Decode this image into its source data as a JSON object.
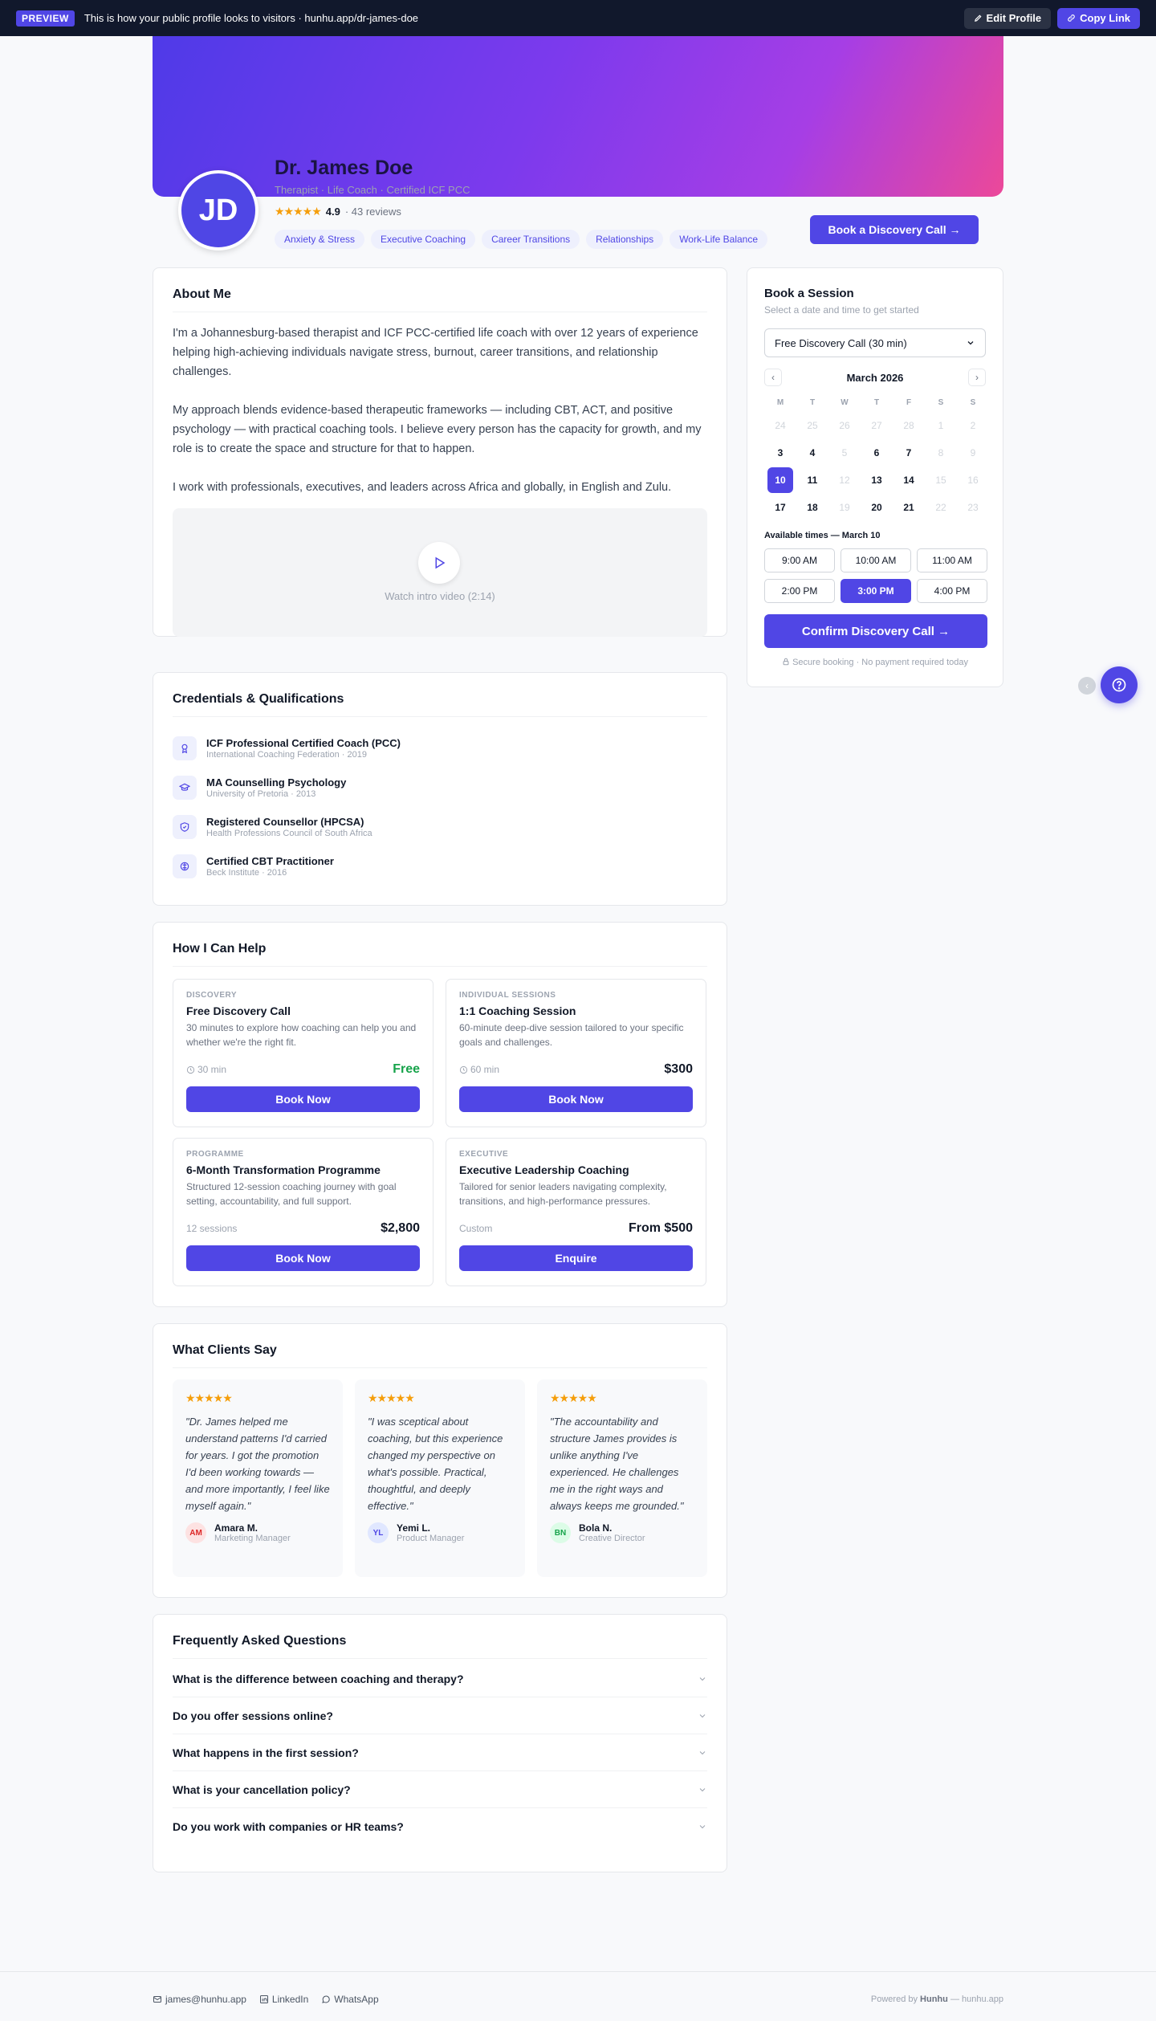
{
  "topbar": {
    "badge": "PREVIEW",
    "message": "This is how your public profile looks to visitors · hunhu.app/dr-james-doe",
    "edit_label": "Edit Profile",
    "copy_label": "Copy Link"
  },
  "profile": {
    "initials": "JD",
    "name": "Dr. James Doe",
    "title": "Therapist · Life Coach · Certified ICF PCC",
    "stars": "★★★★★",
    "rating": "4.9",
    "reviews": "· 43 reviews",
    "tags": [
      "Anxiety & Stress",
      "Executive Coaching",
      "Career Transitions",
      "Relationships",
      "Work-Life Balance"
    ],
    "cta": "Book a Discovery Call →"
  },
  "about": {
    "heading": "About Me",
    "paragraphs": [
      "I'm a Johannesburg-based therapist and ICF PCC-certified life coach with over 12 years of experience helping high-achieving individuals navigate stress, burnout, career transitions, and relationship challenges.",
      "My approach blends evidence-based therapeutic frameworks — including CBT, ACT, and positive psychology — with practical coaching tools. I believe every person has the capacity for growth, and my role is to create the space and structure for that to happen.",
      "I work with professionals, executives, and leaders across Africa and globally, in English and Zulu."
    ],
    "video_label": "Watch intro video (2:14)"
  },
  "credentials": {
    "heading": "Credentials & Qualifications",
    "items": [
      {
        "title": "ICF Professional Certified Coach (PCC)",
        "sub": "International Coaching Federation · 2019",
        "icon": "award-icon"
      },
      {
        "title": "MA Counselling Psychology",
        "sub": "University of Pretoria · 2013",
        "icon": "graduation-cap-icon"
      },
      {
        "title": "Registered Counsellor (HPCSA)",
        "sub": "Health Professions Council of South Africa",
        "icon": "shield-icon"
      },
      {
        "title": "Certified CBT Practitioner",
        "sub": "Beck Institute · 2016",
        "icon": "brain-icon"
      }
    ]
  },
  "services": {
    "heading": "How I Can Help",
    "items": [
      {
        "kicker": "DISCOVERY",
        "title": "Free Discovery Call",
        "desc": "30 minutes to explore how coaching can help you and whether we're the right fit.",
        "meta": "30 min",
        "price": "Free",
        "button": "Book Now"
      },
      {
        "kicker": "INDIVIDUAL SESSIONS",
        "title": "1:1 Coaching Session",
        "desc": "60-minute deep-dive session tailored to your specific goals and challenges.",
        "meta": "60 min",
        "price": "$300",
        "button": "Book Now"
      },
      {
        "kicker": "PROGRAMME",
        "title": "6-Month Transformation Programme",
        "desc": "Structured 12-session coaching journey with goal setting, accountability, and full support.",
        "meta": "12 sessions",
        "price": "$2,800",
        "button": "Book Now"
      },
      {
        "kicker": "EXECUTIVE",
        "title": "Executive Leadership Coaching",
        "desc": "Tailored for senior leaders navigating complexity, transitions, and high-performance pressures.",
        "meta": "Custom",
        "price": "From $500",
        "button": "Enquire"
      }
    ]
  },
  "testimonials": {
    "heading": "What Clients Say",
    "items": [
      {
        "stars": "★★★★★",
        "quote": "\"Dr. James helped me understand patterns I'd carried for years. I got the promotion I'd been working towards — and more importantly, I feel like myself again.\"",
        "initials": "AM",
        "name": "Amara M.",
        "role": "Marketing Manager",
        "bg": "#fde2e2",
        "fg": "#dc2626"
      },
      {
        "stars": "★★★★★",
        "quote": "\"I was sceptical about coaching, but this experience changed my perspective on what's possible. Practical, thoughtful, and deeply effective.\"",
        "initials": "YL",
        "name": "Yemi L.",
        "role": "Product Manager",
        "bg": "#e0e7ff",
        "fg": "#4f46e5"
      },
      {
        "stars": "★★★★★",
        "quote": "\"The accountability and structure James provides is unlike anything I've experienced. He challenges me in the right ways and always keeps me grounded.\"",
        "initials": "BN",
        "name": "Bola N.",
        "role": "Creative Director",
        "bg": "#dcfce7",
        "fg": "#16a34a"
      }
    ]
  },
  "faq": {
    "heading": "Frequently Asked Questions",
    "items": [
      "What is the difference between coaching and therapy?",
      "Do you offer sessions online?",
      "What happens in the first session?",
      "What is your cancellation policy?",
      "Do you work with companies or HR teams?"
    ]
  },
  "booking": {
    "title": "Book a Session",
    "subtitle": "Select a date and time to get started",
    "session_type": "Free Discovery Call (30 min)",
    "month": "March 2026",
    "weekdays": [
      "M",
      "T",
      "W",
      "T",
      "F",
      "S",
      "S"
    ],
    "days": [
      {
        "d": "24",
        "m": true
      },
      {
        "d": "25",
        "m": true
      },
      {
        "d": "26",
        "m": true
      },
      {
        "d": "27",
        "m": true
      },
      {
        "d": "28",
        "m": true
      },
      {
        "d": "1",
        "m": true
      },
      {
        "d": "2",
        "m": true
      },
      {
        "d": "3"
      },
      {
        "d": "4"
      },
      {
        "d": "5",
        "m": true
      },
      {
        "d": "6"
      },
      {
        "d": "7"
      },
      {
        "d": "8",
        "m": true
      },
      {
        "d": "9",
        "m": true
      },
      {
        "d": "10",
        "s": true
      },
      {
        "d": "11"
      },
      {
        "d": "12",
        "m": true
      },
      {
        "d": "13"
      },
      {
        "d": "14"
      },
      {
        "d": "15",
        "m": true
      },
      {
        "d": "16",
        "m": true
      },
      {
        "d": "17"
      },
      {
        "d": "18"
      },
      {
        "d": "19",
        "m": true
      },
      {
        "d": "20"
      },
      {
        "d": "21"
      },
      {
        "d": "22",
        "m": true
      },
      {
        "d": "23",
        "m": true
      }
    ],
    "times_label": "Available times — March 10",
    "times": [
      "9:00 AM",
      "10:00 AM",
      "11:00 AM",
      "2:00 PM",
      "3:00 PM",
      "4:00 PM"
    ],
    "selected_time": "3:00 PM",
    "confirm": "Confirm Discovery Call →",
    "secure": "Secure booking · No payment required today"
  },
  "footer": {
    "email": "james@hunhu.app",
    "linkedin": "LinkedIn",
    "whatsapp": "WhatsApp",
    "powered_prefix": "Powered by",
    "brand": "Hunhu",
    "powered_suffix": "— hunhu.app"
  },
  "colors": {
    "accent": "#5046e5",
    "topbar": "#11182c",
    "price_free": "#16a34a",
    "stars": "#f59e0b"
  }
}
